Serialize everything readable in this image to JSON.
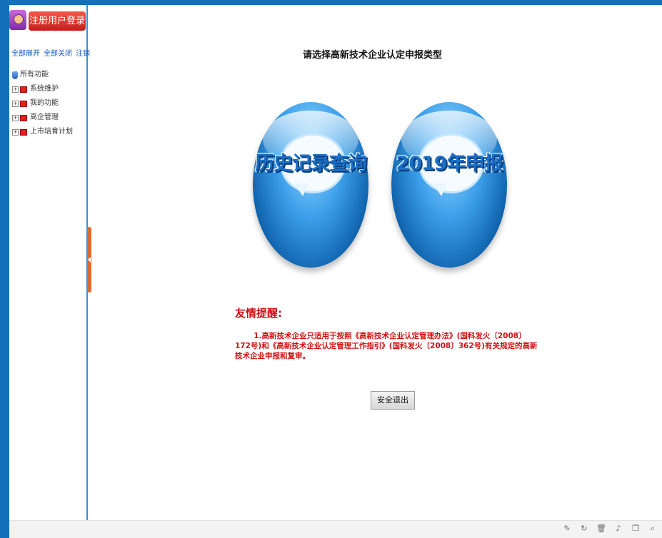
{
  "sidebar": {
    "login_label": "注册用户登录",
    "links": {
      "expand_all": "全部展开",
      "collapse_all": "全部关闭",
      "logout": "注销"
    },
    "root_label": "所有功能",
    "items": [
      {
        "label": "系统维护"
      },
      {
        "label": "我的功能"
      },
      {
        "label": "高企管理"
      },
      {
        "label": "上市培育计划"
      }
    ]
  },
  "main": {
    "title": "请选择高新技术企业认定申报类型",
    "buttons": {
      "history": "历史记录查询",
      "apply": "2019年申报"
    },
    "notice_title": "友情提醒:",
    "notice_body": "1.高新技术企业只适用于按照《高新技术企业认定管理办法》(国科发火〔2008〕172号)和《高新技术企业认定管理工作指引》(国科发火〔2008〕362号)有关规定的高新技术企业申报和复审。",
    "logout_button": "安全退出"
  },
  "toolbar_icons": [
    "brush-icon",
    "refresh-icon",
    "trash-icon",
    "speaker-icon",
    "copy-icon",
    "search-icon"
  ],
  "colors": {
    "frame_blue": "#1470b8",
    "notice_red": "#d01010",
    "login_red": "#d62a22"
  }
}
